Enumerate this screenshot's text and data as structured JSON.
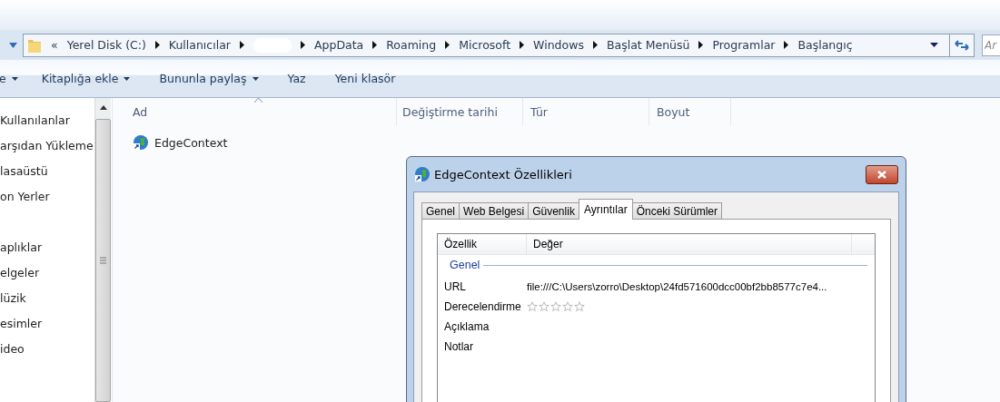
{
  "address_bar": {
    "overflow": "«",
    "segments": [
      {
        "kind": "folder",
        "label": "Yerel Disk (C:)"
      },
      {
        "kind": "folder",
        "label": "Kullanıcılar"
      },
      {
        "kind": "redacted"
      },
      {
        "kind": "folder",
        "label": "AppData"
      },
      {
        "kind": "folder",
        "label": "Roaming"
      },
      {
        "kind": "folder",
        "label": "Microsoft"
      },
      {
        "kind": "folder",
        "label": "Windows"
      },
      {
        "kind": "folder",
        "label": "Başlat Menüsü"
      },
      {
        "kind": "folder",
        "label": "Programlar"
      },
      {
        "kind": "folder",
        "label": "Başlangıç"
      }
    ]
  },
  "search": {
    "placeholder": "Ar"
  },
  "toolbar": [
    {
      "label": "e",
      "dropdown": true
    },
    {
      "label": "Kitaplığa ekle",
      "dropdown": true
    },
    {
      "label": "Bununla paylaş",
      "dropdown": true
    },
    {
      "label": "Yaz",
      "dropdown": false
    },
    {
      "label": "Yeni klasör",
      "dropdown": false
    }
  ],
  "sidebar": {
    "groups": [
      {
        "items": [
          "Kullanılanlar",
          "arşıdan Yükleme",
          "lasaüstü",
          "on Yerler"
        ]
      },
      {
        "items": [
          "aplıklar",
          "elgeler",
          "lüzik",
          "esimler",
          "ideo"
        ]
      }
    ]
  },
  "file_list": {
    "columns": [
      {
        "label": "Ad",
        "sorted": true
      },
      {
        "label": "Değiştirme tarihi",
        "sorted": false
      },
      {
        "label": "Tür",
        "sorted": false
      },
      {
        "label": "Boyut",
        "sorted": false
      }
    ],
    "rows": [
      {
        "name": "EdgeContext"
      }
    ]
  },
  "dialog": {
    "title": "EdgeContext Özellikleri",
    "tabs": [
      {
        "label": "Genel",
        "selected": false
      },
      {
        "label": "Web Belgesi",
        "selected": false
      },
      {
        "label": "Güvenlik",
        "selected": false
      },
      {
        "label": "Ayrıntılar",
        "selected": true
      },
      {
        "label": "Önceki Sürümler",
        "selected": false
      }
    ],
    "columns": [
      "Özellik",
      "Değer"
    ],
    "group": "Genel",
    "properties": [
      {
        "kind": "text",
        "name": "URL",
        "value": "file:///C:\\Users\\zorro\\Desktop\\24fd571600dcc00bf2bb8577c7e4..."
      },
      {
        "kind": "rating",
        "name": "Derecelendirme",
        "stars": 0
      },
      {
        "kind": "text",
        "name": "Açıklama"
      },
      {
        "kind": "text",
        "name": "Notlar"
      }
    ]
  }
}
